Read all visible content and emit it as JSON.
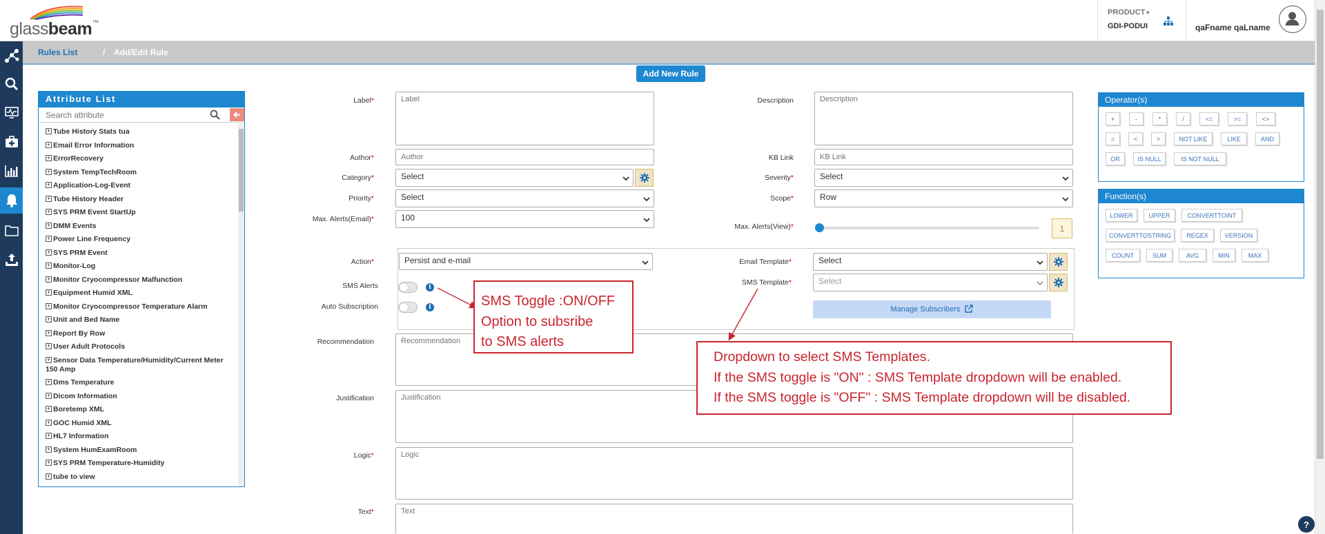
{
  "header": {
    "logo_text_a": "glass",
    "logo_text_b": "beam",
    "logo_tm": "™",
    "product_label": "PRODUCT",
    "product_value": "GDI-PODUI",
    "user_name": "qaFname qaLname"
  },
  "sidebar": {
    "items": [
      "network-icon",
      "search-icon",
      "monitor-icon",
      "medical-kit-icon",
      "bar-chart-icon",
      "bell-icon",
      "folder-icon",
      "upload-icon"
    ],
    "active_index": 5
  },
  "breadcrumb": {
    "link": "Rules List",
    "separator": "/",
    "current": "Add/Edit Rule"
  },
  "add_new_rule": "Add New Rule",
  "attribute_list": {
    "title": "Attribute List",
    "search_placeholder": "Search attribute",
    "items": [
      "Tube History Stats tua",
      "Email Error Information",
      "ErrorRecovery",
      "System TempTechRoom",
      "Application-Log-Event",
      "Tube History Header",
      "SYS PRM Event StartUp",
      "DMM Events",
      "Power Line Frequency",
      "SYS PRM Event",
      "Monitor-Log",
      "Monitor Cryocompressor Malfunction",
      "Equipment Humid XML",
      "Monitor Cryocompressor Temperature Alarm",
      "Unit and Bed Name",
      "Report By Row",
      "User Adult Protocols",
      "Sensor Data Temperature/Humidity/Current Meter 150 Amp",
      "Dms Temperature",
      "Dicom Information",
      "Boretemp XML",
      "GOC Humid XML",
      "HL7 Information",
      "System HumExamRoom",
      "SYS PRM Temperature-Humidity",
      "tube to view"
    ]
  },
  "form": {
    "label": {
      "label": "Label",
      "placeholder": "Label"
    },
    "description": {
      "label": "Description",
      "placeholder": "Description"
    },
    "author": {
      "label": "Author",
      "placeholder": "Author"
    },
    "kb_link": {
      "label": "KB Link",
      "placeholder": "KB Link"
    },
    "category": {
      "label": "Category",
      "value": "Select"
    },
    "severity": {
      "label": "Severity",
      "value": "Select"
    },
    "priority": {
      "label": "Priority",
      "value": "Select"
    },
    "scope": {
      "label": "Scope",
      "value": "Row"
    },
    "max_alerts_email": {
      "label": "Max. Alerts(Email)",
      "value": "100"
    },
    "max_alerts_view": {
      "label": "Max. Alerts(View)",
      "value": "1",
      "slider_fraction": 0.0
    },
    "action": {
      "label": "Action",
      "value": "Persist and e-mail"
    },
    "email_template": {
      "label": "Email Template",
      "value": "Select"
    },
    "sms_alerts": {
      "label": "SMS Alerts",
      "on": false
    },
    "sms_template": {
      "label": "SMS Template",
      "value": "Select"
    },
    "auto_subscription": {
      "label": "Auto Subscription",
      "on": false
    },
    "manage_subscribers": "Manage Subscribers",
    "recommendation": {
      "label": "Recommendation",
      "placeholder": "Recommendation"
    },
    "justification": {
      "label": "Justification",
      "placeholder": "Justification"
    },
    "logic": {
      "label": "Logic",
      "placeholder": "Logic"
    },
    "text": {
      "label": "Text",
      "placeholder": "Text"
    },
    "required_mark": "*"
  },
  "operators": {
    "title": "Operator(s)",
    "items": [
      "+",
      "-",
      "*",
      "/",
      "<=",
      ">=",
      "<>",
      "=",
      "<",
      ">",
      "NOT LIKE",
      "LIKE",
      "AND",
      "OR",
      "IS NULL",
      "IS NOT NULL"
    ]
  },
  "functions": {
    "title": "Function(s)",
    "items": [
      "LOWER",
      "UPPER",
      "CONVERTTOINT",
      "CONVERTTOSTRING",
      "REGEX",
      "VERSION",
      "COUNT",
      "SUM",
      "AVG",
      "MIN",
      "MAX"
    ]
  },
  "annotations": {
    "sms_toggle": [
      "SMS Toggle :ON/OFF",
      "Option to subsribe",
      "to SMS alerts"
    ],
    "sms_template": [
      "Dropdown to select SMS Templates.",
      "If the SMS toggle is \"ON\" : SMS Template dropdown will be enabled.",
      "If the SMS toggle is \"OFF\" : SMS Template dropdown will be disabled."
    ],
    "color": "#c9252f"
  },
  "help_label": "?",
  "colors": {
    "primary": "#1d87d0",
    "sidebar": "#1e3b5e",
    "breadcrumb_bg": "#c8c8c8",
    "gear_bg": "#f0e4c6",
    "manage_bg": "#c5d8f5"
  }
}
